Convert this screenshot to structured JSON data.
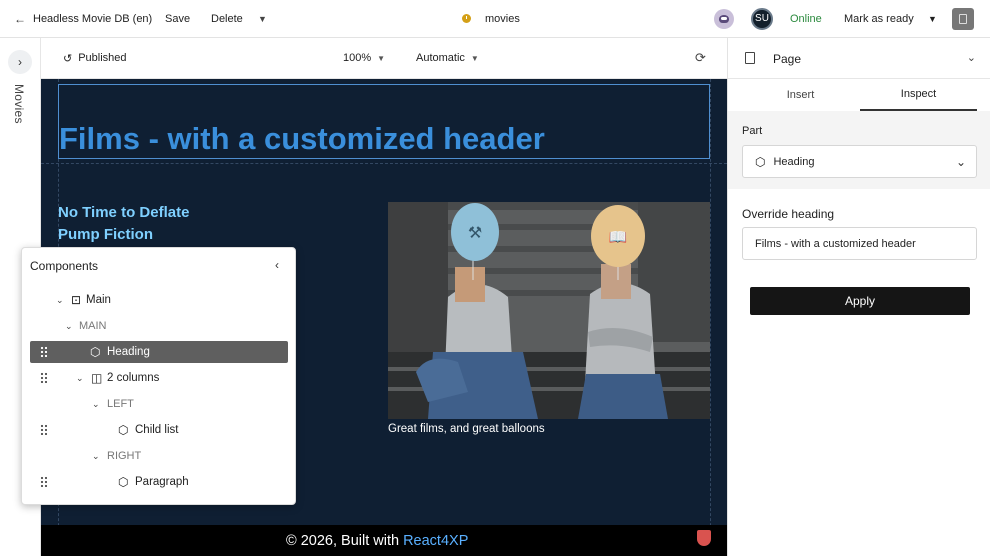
{
  "topbar": {
    "back_label": "Headless Movie DB (en)",
    "save_label": "Save",
    "delete_label": "Delete",
    "content_name": "movies",
    "avatar_initials": "SU",
    "status": "Online",
    "mark_ready_label": "Mark as ready"
  },
  "rail": {
    "label": "Movies"
  },
  "preview_toolbar": {
    "status": "Published",
    "zoom": "100%",
    "mode": "Automatic"
  },
  "canvas": {
    "heading": "Films - with a customized header",
    "films": [
      "No Time to Deflate",
      "Pump Fiction"
    ],
    "caption": "Great films, and great balloons",
    "footer_prefix": "© 2026, Built with ",
    "footer_link": "React4XP"
  },
  "components": {
    "title": "Components",
    "rows": {
      "main": "Main",
      "main_region": "MAIN",
      "heading": "Heading",
      "two_columns": "2 columns",
      "left_region": "LEFT",
      "child_list": "Child list",
      "right_region": "RIGHT",
      "paragraph": "Paragraph"
    }
  },
  "inspect": {
    "panel_title": "Page",
    "tabs": [
      "Insert",
      "Inspect"
    ],
    "active_tab": "Inspect",
    "part_label": "Part",
    "part_value": "Heading",
    "override_label": "Override heading",
    "override_value": "Films - with a customized header",
    "apply_label": "Apply"
  },
  "colors": {
    "canvas_bg": "#0f1f33",
    "heading": "#3a8fdc",
    "film_link": "#7fd0ff",
    "online": "#2b8a3e",
    "apply_bg": "#151515",
    "selected_row": "#5f5f5f"
  }
}
